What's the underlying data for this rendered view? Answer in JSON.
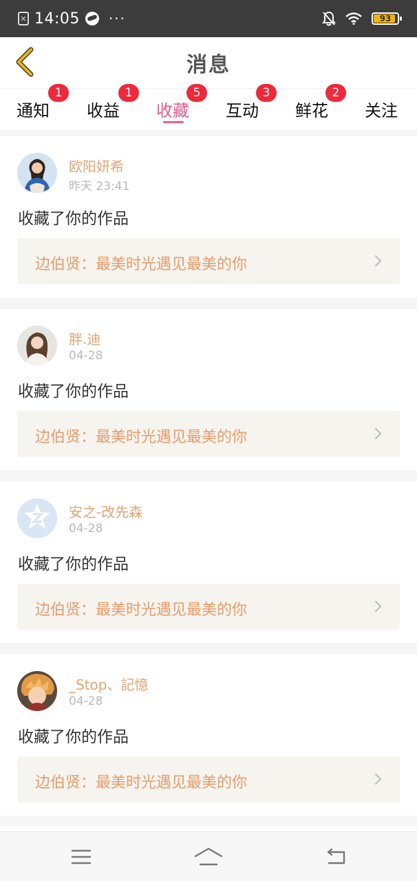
{
  "status_bar": {
    "time": "14:05",
    "dots": "···",
    "battery": "93",
    "battery_level": 0.93,
    "icons": [
      "sim-card-icon",
      "cloud-icon",
      "more-dots-icon",
      "notifications-off-icon",
      "wifi-icon",
      "battery-icon"
    ]
  },
  "header": {
    "title": "消息",
    "back_icon": "chevron-left-icon"
  },
  "tabs": [
    {
      "label": "通知",
      "badge": "1",
      "active": false
    },
    {
      "label": "收益",
      "badge": "1",
      "active": false
    },
    {
      "label": "收藏",
      "badge": "5",
      "active": true
    },
    {
      "label": "互动",
      "badge": "3",
      "active": false
    },
    {
      "label": "鲜花",
      "badge": "2",
      "active": false
    },
    {
      "label": "关注",
      "badge": "",
      "active": false
    }
  ],
  "feed": [
    {
      "username": "欧阳妍希",
      "time": "昨天 23:41",
      "action": "收藏了你的作品",
      "work": "边伯贤：最美时光遇见最美的你"
    },
    {
      "username": "胖.迪",
      "time": "04-28",
      "action": "收藏了你的作品",
      "work": "边伯贤：最美时光遇见最美的你"
    },
    {
      "username": "安之-改先森",
      "time": "04-28",
      "action": "收藏了你的作品",
      "work": "边伯贤：最美时光遇见最美的你"
    },
    {
      "username": "_Stop、記憶",
      "time": "04-28",
      "action": "收藏了你的作品",
      "work": "边伯贤：最美时光遇见最美的你"
    }
  ],
  "colors": {
    "accent": "#ea5b8f",
    "badge": "#f0283c",
    "username": "#e9a26f",
    "work_link_text": "#e99b69",
    "work_link_bg": "#f5f4ee",
    "status_bar": "#3c3c3c",
    "back_arrow": "#e8b820"
  },
  "nav_bar": {
    "icons": [
      "menu-icon",
      "home-icon",
      "back-icon"
    ]
  }
}
